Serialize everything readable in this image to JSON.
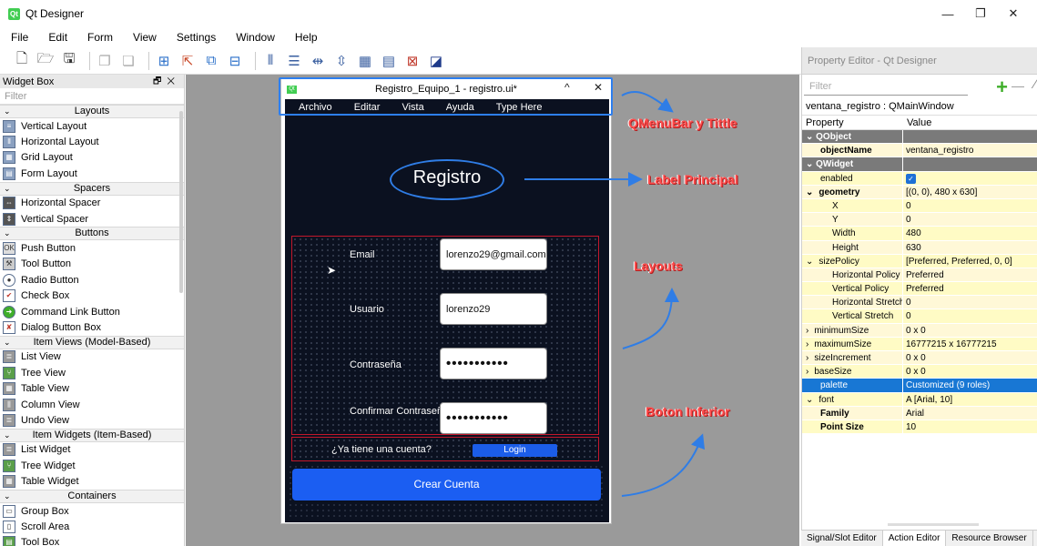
{
  "app": {
    "title": "Qt Designer",
    "icon": "Qt"
  },
  "window_controls": [
    "—",
    "❐",
    "✕"
  ],
  "menu": [
    "File",
    "Edit",
    "Form",
    "View",
    "Settings",
    "Window",
    "Help"
  ],
  "widget_box": {
    "title": "Widget Box",
    "filter_placeholder": "Filter",
    "sections": [
      {
        "name": "Layouts",
        "items": [
          "Vertical Layout",
          "Horizontal Layout",
          "Grid Layout",
          "Form Layout"
        ]
      },
      {
        "name": "Spacers",
        "items": [
          "Horizontal Spacer",
          "Vertical Spacer"
        ]
      },
      {
        "name": "Buttons",
        "items": [
          "Push Button",
          "Tool Button",
          "Radio Button",
          "Check Box",
          "Command Link Button",
          "Dialog Button Box"
        ]
      },
      {
        "name": "Item Views (Model-Based)",
        "items": [
          "List View",
          "Tree View",
          "Table View",
          "Column View",
          "Undo View"
        ]
      },
      {
        "name": "Item Widgets (Item-Based)",
        "items": [
          "List Widget",
          "Tree Widget",
          "Table Widget"
        ]
      },
      {
        "name": "Containers",
        "items": [
          "Group Box",
          "Scroll Area",
          "Tool Box"
        ]
      }
    ]
  },
  "form": {
    "title": "Registro_Equipo_1 - registro.ui*",
    "min": "^",
    "close": "✕",
    "menu": [
      "Archivo",
      "Editar",
      "Vista",
      "Ayuda",
      "Type Here"
    ],
    "main_label": "Registro",
    "fields": [
      {
        "label": "Email",
        "value": "lorenzo29@gmail.com"
      },
      {
        "label": "Usuario",
        "value": "lorenzo29"
      },
      {
        "label": "Contraseña",
        "value": "•••••••••••"
      },
      {
        "label": "Confirmar Contraseña",
        "value": "•••••••••••"
      }
    ],
    "account_text": "¿Ya tiene una cuenta?",
    "login_label": "Login",
    "create_label": "Crear Cuenta"
  },
  "annotations": {
    "menubar": "QMenuBar y Tittle",
    "label": "Label Principal",
    "layouts": "Layouts",
    "button": "Boton Inferior"
  },
  "property_editor": {
    "title": "Property Editor - Qt Designer",
    "filter_placeholder": "Filter",
    "object": "ventana_registro : QMainWindow",
    "header": {
      "property": "Property",
      "value": "Value"
    },
    "rows": [
      {
        "k": "QObject",
        "v": "",
        "type": "section"
      },
      {
        "k": "objectName",
        "v": "ventana_registro",
        "type": "y1 bold"
      },
      {
        "k": "QWidget",
        "v": "",
        "type": "section"
      },
      {
        "k": "enabled",
        "v": "",
        "type": "y2"
      },
      {
        "k": "geometry",
        "v": "[(0, 0), 480 x 630]",
        "type": "y1 bold indent1",
        "chev": "⌄"
      },
      {
        "k": "X",
        "v": "0",
        "type": "y2 indent2"
      },
      {
        "k": "Y",
        "v": "0",
        "type": "y1 indent2"
      },
      {
        "k": "Width",
        "v": "480",
        "type": "y2 indent2"
      },
      {
        "k": "Height",
        "v": "630",
        "type": "y1 indent2"
      },
      {
        "k": "sizePolicy",
        "v": "[Preferred, Preferred, 0, 0]",
        "type": "y2 indent1",
        "chev": "⌄"
      },
      {
        "k": "Horizontal Policy",
        "v": "Preferred",
        "type": "y1 indent2"
      },
      {
        "k": "Vertical Policy",
        "v": "Preferred",
        "type": "y2 indent2"
      },
      {
        "k": "Horizontal Stretch",
        "v": "0",
        "type": "y1 indent2"
      },
      {
        "k": "Vertical Stretch",
        "v": "0",
        "type": "y2 indent2"
      },
      {
        "k": "minimumSize",
        "v": "0 x 0",
        "type": "y1 indent1",
        "chev": "›"
      },
      {
        "k": "maximumSize",
        "v": "16777215 x 16777215",
        "type": "y2 indent1",
        "chev": "›"
      },
      {
        "k": "sizeIncrement",
        "v": "0 x 0",
        "type": "y1 indent1",
        "chev": "›"
      },
      {
        "k": "baseSize",
        "v": "0 x 0",
        "type": "y2 indent1",
        "chev": "›"
      },
      {
        "k": "palette",
        "v": "Customized (9 roles)",
        "type": "sel"
      },
      {
        "k": "font",
        "v": "A  [Arial, 10]",
        "type": "y2 indent1",
        "chev": "⌄"
      },
      {
        "k": "Family",
        "v": "Arial",
        "type": "y1 bold"
      },
      {
        "k": "Point Size",
        "v": "10",
        "type": "y2 bold"
      }
    ]
  },
  "bottom_tabs": [
    "Signal/Slot Editor",
    "Action Editor",
    "Resource Browser"
  ]
}
